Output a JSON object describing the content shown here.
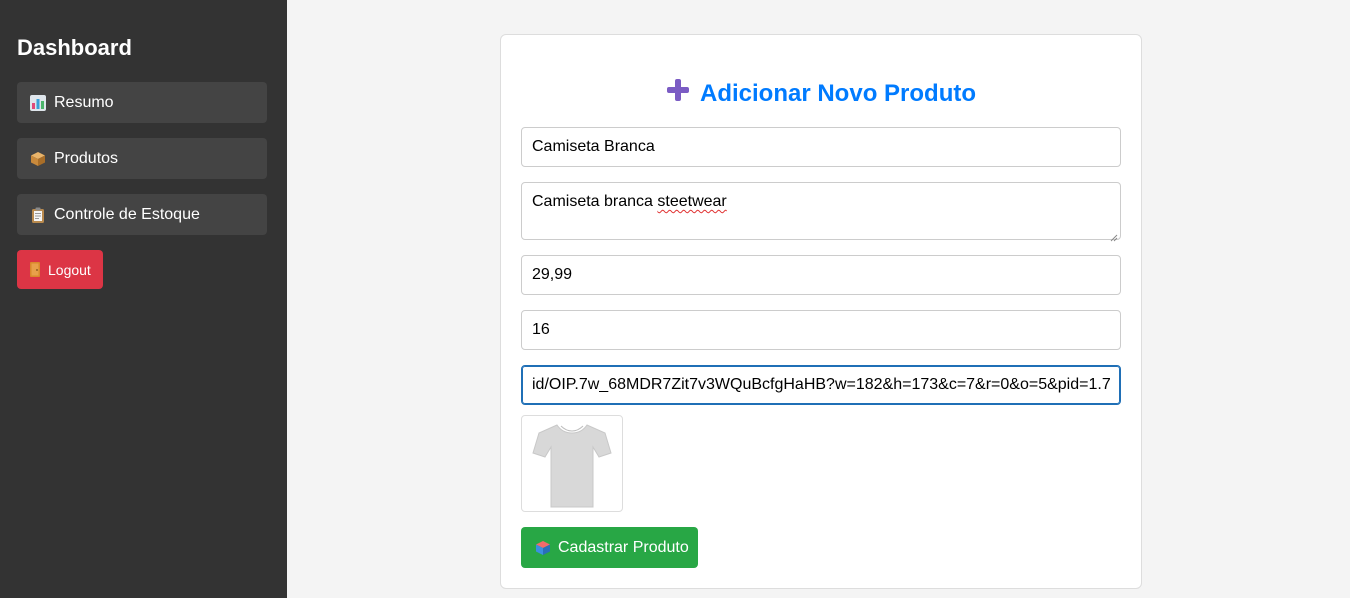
{
  "sidebar": {
    "title": "Dashboard",
    "items": [
      {
        "label": "Resumo",
        "icon": "bar-chart-icon"
      },
      {
        "label": "Produtos",
        "icon": "package-icon"
      },
      {
        "label": "Controle de Estoque",
        "icon": "clipboard-icon"
      }
    ],
    "logout": {
      "label": "Logout",
      "icon": "door-icon",
      "color": "#dc3545"
    }
  },
  "form": {
    "title": "Adicionar Novo Produto",
    "title_icon": "plus-icon",
    "title_color": "#007bff",
    "name_value": "Camiseta Branca",
    "description_value_part1": "Camiseta branca ",
    "description_value_misspelled": "steetwear",
    "price_value": "29,99",
    "quantity_value": "16",
    "image_url_value": "id/OIP.7w_68MDR7Zit7v3WQuBcfgHaHB?w=182&h=173&c=7&r=0&o=5&pid=1.7",
    "preview_icon": "tshirt-image",
    "submit_label": "Cadastrar Produto",
    "submit_icon": "package-icon",
    "submit_color": "#28a745"
  }
}
